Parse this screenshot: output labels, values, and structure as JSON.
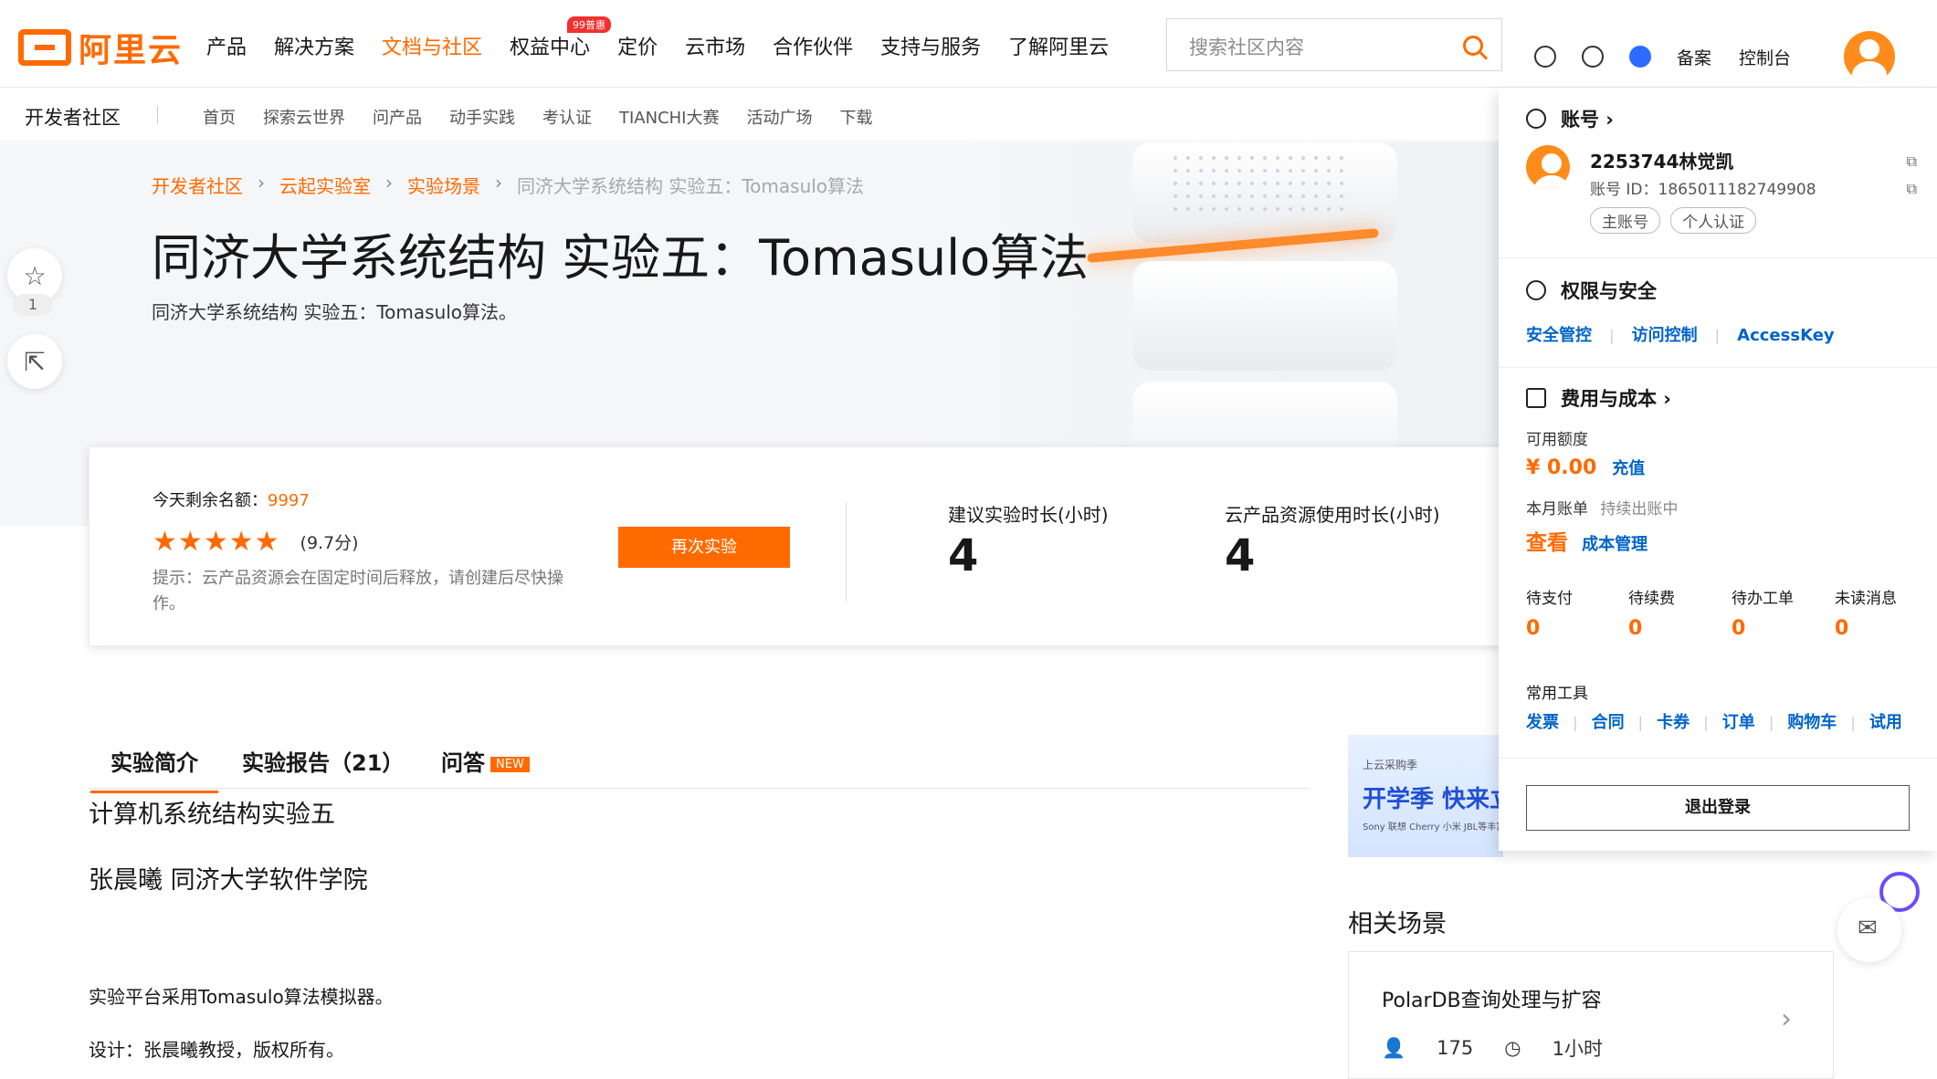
{
  "header": {
    "logo_text": "阿里云",
    "nav": [
      {
        "label": "产品"
      },
      {
        "label": "解决方案"
      },
      {
        "label": "文档与社区",
        "active": true
      },
      {
        "label": "权益中心",
        "badge": "99普惠"
      },
      {
        "label": "定价"
      },
      {
        "label": "云市场"
      },
      {
        "label": "合作伙伴"
      },
      {
        "label": "支持与服务"
      },
      {
        "label": "了解阿里云"
      }
    ],
    "search_placeholder": "搜索社区内容",
    "icons": [
      "gauge-icon",
      "cloud-support-icon",
      "star-icon"
    ],
    "record": "备案",
    "console": "控制台"
  },
  "subnav": {
    "title": "开发者社区",
    "links": [
      "首页",
      "探索云世界",
      "问产品",
      "动手实践",
      "考认证",
      "TIANCHI大赛",
      "活动广场",
      "下载"
    ]
  },
  "hero": {
    "breadcrumb": [
      "开发者社区",
      "云起实验室",
      "实验场景",
      "同济大学系统结构 实验五：Tomasulo算法"
    ],
    "title": "同济大学系统结构 实验五：Tomasulo算法",
    "subtitle": "同济大学系统结构 实验五：Tomasulo算法。",
    "favorite_count": "1"
  },
  "card": {
    "quota_label": "今天剩余名额：",
    "quota_value": "9997",
    "rating": 5,
    "score": "(9.7分)",
    "tip": "提示：云产品资源会在固定时间后释放，请创建后尽快操作。",
    "button": "再次实验",
    "stat1_label": "建议实验时长(小时)",
    "stat1_value": "4",
    "stat2_label": "云产品资源使用时长(小时)",
    "stat2_value": "4"
  },
  "tabs": {
    "intro": "实验简介",
    "report": "实验报告（21）",
    "qa": "问答",
    "qa_badge": "NEW"
  },
  "content": {
    "heading": "计算机系统结构实验五",
    "author": "张晨曦 同济大学软件学院",
    "p1": "实验平台采用Tomasulo算法模拟器。",
    "p2": "设计：张晨曦教授，版权所有。"
  },
  "ad": {
    "line1": "上云采购季",
    "line2": "开学季 快来立",
    "line3": "Sony 联想 Cherry 小米 JBL等丰富开学"
  },
  "related": {
    "title": "相关场景",
    "item_title": "PolarDB查询处理与扩容",
    "item_users": "175",
    "item_duration": "1小时"
  },
  "panel": {
    "account_title": "账号 ›",
    "username": "2253744林觉凯",
    "account_id": "账号 ID：1865011182749908",
    "tags": [
      "主账号",
      "个人认证"
    ],
    "perm_title": "权限与安全",
    "perm_links": [
      "安全管控",
      "访问控制",
      "AccessKey"
    ],
    "cost_title": "费用与成本 ›",
    "balance_label": "可用额度",
    "balance": "¥ 0.00",
    "recharge": "充值",
    "bill_label": "本月账单",
    "bill_status": "持续出账中",
    "view": "查看",
    "cost_manage": "成本管理",
    "todos": [
      {
        "label": "待支付",
        "value": "0"
      },
      {
        "label": "待续费",
        "value": "0"
      },
      {
        "label": "待办工单",
        "value": "0"
      },
      {
        "label": "未读消息",
        "value": "0"
      }
    ],
    "tools_label": "常用工具",
    "tools": [
      "发票",
      "合同",
      "卡券",
      "订单",
      "购物车",
      "试用"
    ],
    "logout": "退出登录"
  }
}
